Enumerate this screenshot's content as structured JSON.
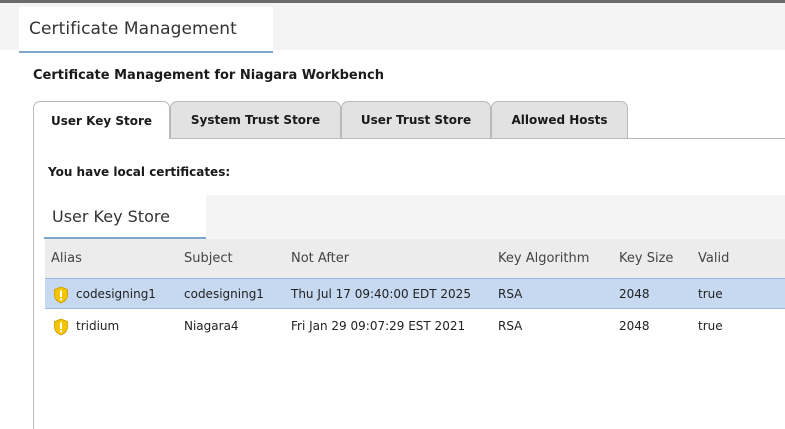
{
  "header": {
    "title": "Certificate Management"
  },
  "page": {
    "heading": "Certificate Management for Niagara Workbench"
  },
  "tabs": [
    {
      "label": "User Key Store",
      "active": true
    },
    {
      "label": "System Trust Store",
      "active": false
    },
    {
      "label": "User Trust Store",
      "active": false
    },
    {
      "label": "Allowed Hosts",
      "active": false
    }
  ],
  "panel": {
    "message": "You have local certificates:",
    "store_title": "User Key Store"
  },
  "table": {
    "columns": [
      "Alias",
      "Subject",
      "Not After",
      "Key Algorithm",
      "Key Size",
      "Valid"
    ],
    "rows": [
      {
        "alias": "codesigning1",
        "subject": "codesigning1",
        "not_after": "Thu Jul 17 09:40:00 EDT 2025",
        "key_algorithm": "RSA",
        "key_size": "2048",
        "valid": "true",
        "selected": true,
        "icon": "shield-warning-icon"
      },
      {
        "alias": "tridium",
        "subject": "Niagara4",
        "not_after": "Fri Jan 29 09:07:29 EST 2021",
        "key_algorithm": "RSA",
        "key_size": "2048",
        "valid": "true",
        "selected": false,
        "icon": "shield-warning-icon"
      }
    ]
  },
  "colors": {
    "accent": "#7ea6cf",
    "selected_row": "#c6d9f1",
    "shield": "#f5c400"
  }
}
